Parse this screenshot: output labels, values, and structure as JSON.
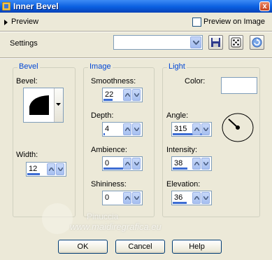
{
  "window": {
    "title": "Inner Bevel",
    "close_label": "x"
  },
  "preview": {
    "label": "Preview",
    "preview_on_image": "Preview on Image"
  },
  "settings": {
    "label": "Settings",
    "selected": ""
  },
  "bevel": {
    "group_title": "Bevel",
    "bevel_label": "Bevel:",
    "width_label": "Width:",
    "width_value": "12"
  },
  "image": {
    "group_title": "Image",
    "smoothness_label": "Smoothness:",
    "smoothness_value": "22",
    "depth_label": "Depth:",
    "depth_value": "4",
    "ambience_label": "Ambience:",
    "ambience_value": "0",
    "shininess_label": "Shininess:",
    "shininess_value": "0"
  },
  "light": {
    "group_title": "Light",
    "color_label": "Color:",
    "color_value": "#ffffff",
    "angle_label": "Angle:",
    "angle_value": "315",
    "intensity_label": "Intensity:",
    "intensity_value": "38",
    "elevation_label": "Elevation:",
    "elevation_value": "36"
  },
  "watermark": {
    "name": "Pinuccia",
    "url": "www.maidiregrafica.eu"
  },
  "buttons": {
    "ok": "OK",
    "cancel": "Cancel",
    "help": "Help"
  },
  "icons": {
    "title": "bevel-app-icon",
    "save": "save-icon",
    "randomize": "dice-icon",
    "reset": "reset-icon"
  },
  "colors": {
    "accent": "#0046d5",
    "titlebar": "#0a5fe0",
    "bar": "#3d6dd3"
  }
}
